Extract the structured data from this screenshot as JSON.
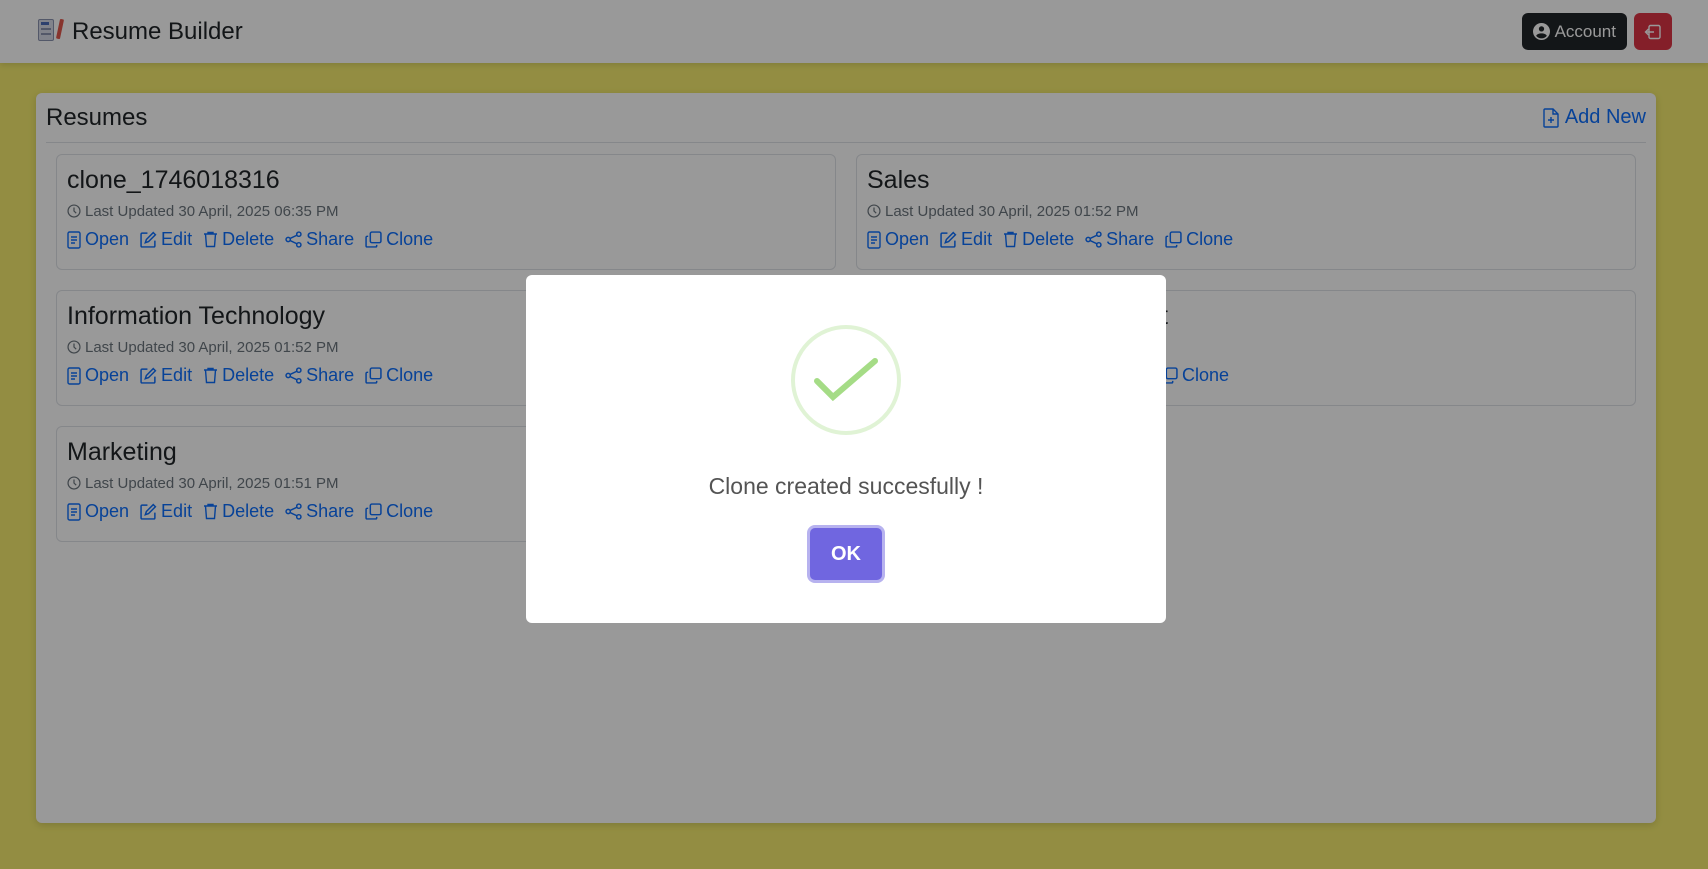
{
  "app": {
    "title": "Resume Builder"
  },
  "nav": {
    "account_label": "Account"
  },
  "colors": {
    "page_bg": "#f5ec6e",
    "link": "#0d6efd",
    "account_btn": "#212529",
    "logout_btn": "#dc3545",
    "ok_btn": "#7066e0",
    "success": "#a5dc86"
  },
  "resumes_panel": {
    "title": "Resumes",
    "add_new_label": "Add New",
    "items": [
      {
        "title": "clone_1746018316",
        "updated": "Last Updated 30 April, 2025 06:35 PM"
      },
      {
        "title": "Sales",
        "updated": "Last Updated 30 April, 2025 01:52 PM"
      },
      {
        "title": "Information Technology",
        "updated": "Last Updated 30 April, 2025 01:52 PM"
      },
      {
        "title": "t",
        "updated": ""
      },
      {
        "title": "Marketing",
        "updated": "Last Updated 30 April, 2025 01:51 PM"
      }
    ],
    "actions": {
      "open": "Open",
      "edit": "Edit",
      "delete": "Delete",
      "share": "Share",
      "clone": "Clone"
    }
  },
  "modal": {
    "icon": "success-check-icon",
    "message": "Clone created succesfully !",
    "ok_label": "OK"
  }
}
